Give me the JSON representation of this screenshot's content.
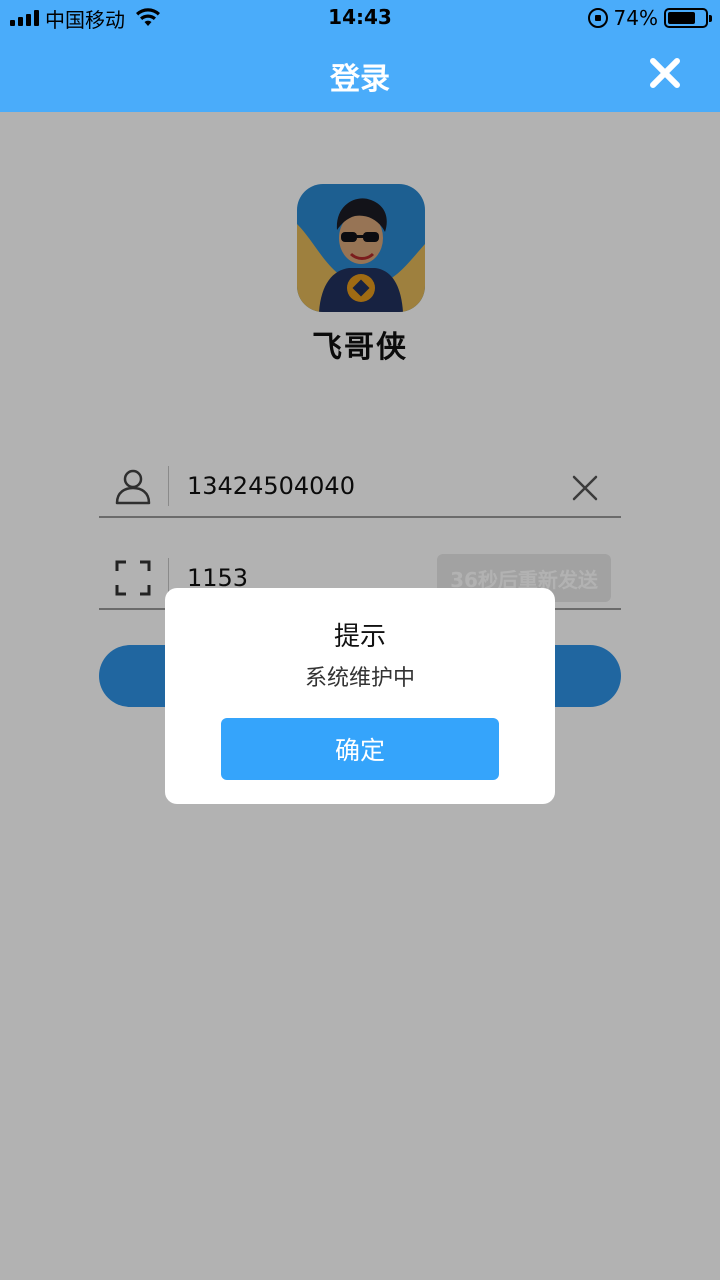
{
  "status_bar": {
    "carrier": "中国移动",
    "time": "14:43",
    "battery_text": "74%",
    "battery_level": 0.74
  },
  "nav": {
    "title": "登录",
    "close_icon": "close-icon"
  },
  "app": {
    "name": "飞哥侠"
  },
  "form": {
    "phone_value": "13424504040",
    "code_value": "1153",
    "resend_label": "36秒后重新发送"
  },
  "dialog": {
    "title": "提示",
    "message": "系统维护中",
    "ok_label": "确定"
  },
  "colors": {
    "nav_blue": "#4aacfa",
    "button_blue": "#35a4fb"
  }
}
